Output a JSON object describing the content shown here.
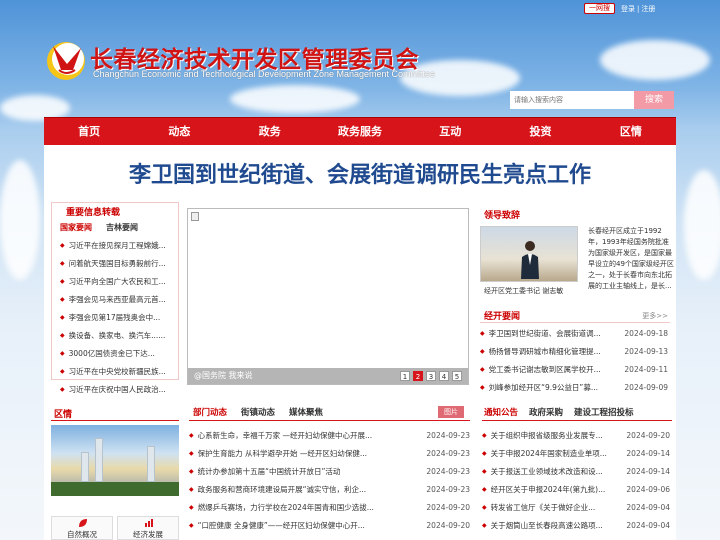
{
  "top_links": {
    "yiwang": "一网搜",
    "login": "登录",
    "separator": "|",
    "register": "注册"
  },
  "header": {
    "title": "长春经济技术开发区管理委员会",
    "subtitle_en": "Changchun Economic and Technological Development Zone Management Committee"
  },
  "search": {
    "placeholder": "请输入搜索内容",
    "button": "搜索"
  },
  "nav": [
    "首页",
    "动态",
    "政务",
    "政务服务",
    "互动",
    "投资",
    "区情"
  ],
  "headline": "李卫国到世纪街道、会展街道调研民生亮点工作",
  "important_news": {
    "title": "重要信息转载",
    "tabs": [
      "国家要闻",
      "吉林要闻"
    ],
    "items": [
      "习近平在接见探月工程嫦娥...",
      "问着航天强国目标勇毅前行...",
      "习近平向全国广大农民和工...",
      "李强会见马来西亚最高元首...",
      "李强会见第17届残奥会中...",
      "换设备、换家电、换汽车......",
      "3000亿国债资金已下达...",
      "习近平在中央党校新疆民族...",
      "习近平在庆祝中国人民政治..."
    ]
  },
  "carousel": {
    "caption": "@国务院 我来说",
    "pages": [
      "1",
      "2",
      "3",
      "4",
      "5"
    ],
    "active_page": 2
  },
  "leader": {
    "title": "领导致辞",
    "caption": "经开区党工委书记  谢志敏",
    "desc": "长春经开区成立于1992年，1993年经国务院批准为国家级开发区，是国家最早设立的49个国家级经开区之一，处于长春市向东北拓展的工业主轴线上，是长..."
  },
  "kf_news": {
    "title": "经开要闻",
    "more": "更多>>",
    "items": [
      {
        "text": "李卫国到世纪街道、会展街道调...",
        "date": "2024-09-18"
      },
      {
        "text": "杨扬督导调研城市精细化管理提...",
        "date": "2024-09-13"
      },
      {
        "text": "党工委书记谢志敏到区属学校开...",
        "date": "2024-09-11"
      },
      {
        "text": "刘峰参加经开区“9.9公益日”募...",
        "date": "2024-09-09"
      }
    ]
  },
  "scenic": {
    "title": "区情",
    "buttons": [
      {
        "label": "自然概况",
        "icon": "leaf-icon"
      },
      {
        "label": "经济发展",
        "icon": "chart-icon"
      }
    ]
  },
  "dept_news": {
    "tabs": [
      "部门动态",
      "街镇动态",
      "媒体聚焦"
    ],
    "badge": "图片",
    "items": [
      {
        "text": "心系新生命，幸福千万家 —经开妇幼保健中心开展...",
        "date": "2024-09-23"
      },
      {
        "text": "保护生育能力 从科学避孕开始 —经开区妇幼保健...",
        "date": "2024-09-23"
      },
      {
        "text": "统计办参加第十五届“中国统计开放日”活动",
        "date": "2024-09-23"
      },
      {
        "text": "政务服务和营商环境建设局开展“诚实守信，利企...",
        "date": "2024-09-23"
      },
      {
        "text": "燃爆乒乓赛场，力行学校在2024年国青和国少选拔...",
        "date": "2024-09-20"
      },
      {
        "text": "“口腔健康 全身健康”——经开区妇幼保健中心开...",
        "date": "2024-09-20"
      }
    ]
  },
  "notices": {
    "tabs": [
      "通知公告",
      "政府采购",
      "建设工程招投标"
    ],
    "items": [
      {
        "text": "关于组织申报省级服务业发展专...",
        "date": "2024-09-20"
      },
      {
        "text": "关于申报2024年国家制造业单项...",
        "date": "2024-09-14"
      },
      {
        "text": "关于报送工业领域技术改造和设...",
        "date": "2024-09-14"
      },
      {
        "text": "经开区关于申报2024年(第九批)...",
        "date": "2024-09-06"
      },
      {
        "text": "转发省工信厅《关于做好企业...",
        "date": "2024-09-04"
      },
      {
        "text": "关于烟筒山至长春段高速公路项...",
        "date": "2024-09-04"
      }
    ]
  },
  "colors": {
    "brand_red": "#d7141a",
    "headline_blue": "#1f4a8f",
    "search_button": "#f29aa6"
  }
}
